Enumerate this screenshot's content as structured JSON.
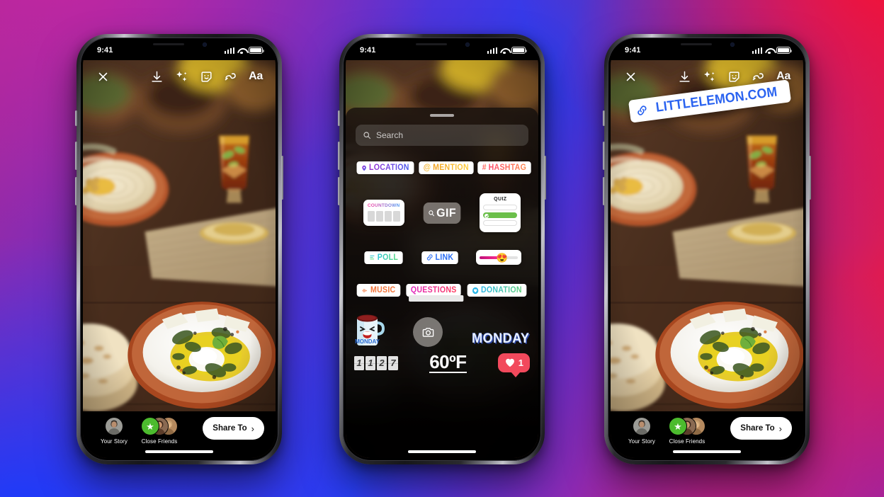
{
  "background": {
    "gradient_colors": [
      "#c426a0",
      "#163cff",
      "#fa102e",
      "#8a28be"
    ],
    "description": "instagram brand gradient"
  },
  "statusbar": {
    "time": "9:41",
    "signal": "cellular-signal",
    "wifi": "wifi",
    "battery": "battery-full"
  },
  "toolbar": {
    "close_icon": "close-x-icon",
    "items": [
      {
        "name": "save-icon",
        "label": "download"
      },
      {
        "name": "effects-icon",
        "label": "sparkles"
      },
      {
        "name": "sticker-icon",
        "label": "sticker-face"
      },
      {
        "name": "draw-icon",
        "label": "squiggle-pen"
      },
      {
        "name": "text-icon",
        "label": "Aa"
      }
    ]
  },
  "bottombar": {
    "your_story_label": "Your Story",
    "close_friends_label": "Close Friends",
    "share_label": "Share To",
    "share_chevron": "›"
  },
  "tray": {
    "search_placeholder": "Search",
    "search_icon": "search-icon",
    "grabber": "drag-handle",
    "row1": [
      {
        "id": "location",
        "label": "LOCATION",
        "icon": "location-pin-icon",
        "gradient": "purple-blue"
      },
      {
        "id": "mention",
        "label": "MENTION",
        "icon": "at-sign-icon",
        "gradient": "orange-yellow"
      },
      {
        "id": "hashtag",
        "label": "HASHTAG",
        "icon": "hash-icon",
        "gradient": "pink-orange"
      }
    ],
    "row2": {
      "countdown": {
        "label": "COUNTDOWN",
        "blocks": 4
      },
      "gif": {
        "label": "GIF",
        "icon": "search-icon"
      },
      "quiz": {
        "label": "QUIZ",
        "options": 3,
        "selected_index": 1
      }
    },
    "row3": [
      {
        "id": "poll",
        "label": "POLL",
        "icon": "poll-bars-icon",
        "gradient": "teal-green"
      },
      {
        "id": "link",
        "label": "LINK",
        "icon": "chain-link-icon",
        "color": "#2a6ef5"
      },
      {
        "id": "slider",
        "label": "emoji-slider",
        "emoji": "😍",
        "fill_percent": 52
      }
    ],
    "row4": [
      {
        "id": "music",
        "label": "MUSIC",
        "icon": "music-waveform-icon",
        "color": "#f2743a"
      },
      {
        "id": "questions",
        "label": "QUESTIONS",
        "gradient": "magenta-red"
      },
      {
        "id": "donation",
        "label": "DONATION",
        "icon": "heart-circle-icon",
        "gradient": "blue-green"
      }
    ],
    "row5": [
      {
        "id": "mug-monday",
        "label": "MONDAY",
        "type": "mug-sticker"
      },
      {
        "id": "camera",
        "label": "camera-sticker",
        "icon": "camera-icon"
      },
      {
        "id": "monday-text",
        "label": "MONDAY",
        "type": "text-sticker"
      }
    ],
    "row6": {
      "counter": {
        "digits": [
          "1",
          "1",
          "2",
          "7"
        ]
      },
      "temperature": {
        "label": "60ºF"
      },
      "like": {
        "icon": "heart-icon",
        "count": "1",
        "color": "#f2495c"
      }
    }
  },
  "link_sticker": {
    "label": "LITTLELEMON.COM",
    "icon": "chain-link-icon",
    "color": "#2a63f0"
  }
}
